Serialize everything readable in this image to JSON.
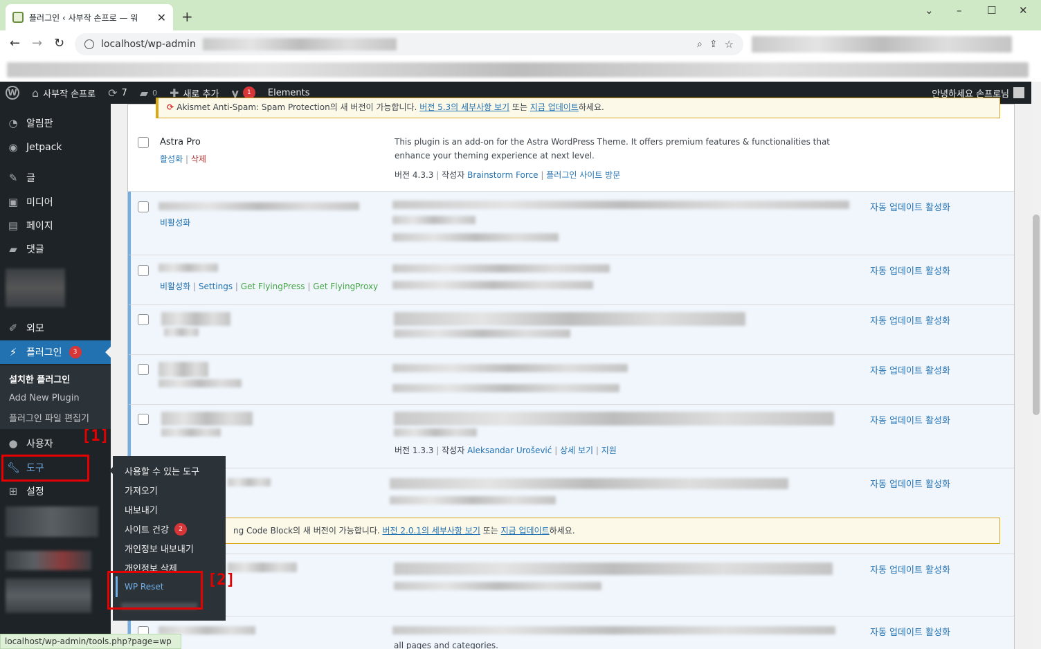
{
  "browser": {
    "tab_title": "플러그인 ‹ 사부작 손프로 — 워",
    "tab_close": "✕",
    "new_tab": "+",
    "url": "localhost/wp-admin",
    "nav_back": "←",
    "nav_forward": "→",
    "nav_reload": "↻",
    "win_min": "–",
    "win_max": "☐",
    "win_close": "✕",
    "win_chevron": "⌄"
  },
  "adminbar": {
    "site_name": "사부작 손프로",
    "updates_count": "7",
    "comments_count": "0",
    "new_label": "새로 추가",
    "yoast_badge": "1",
    "elements_label": "Elements",
    "greeting": "안녕하세요 손프로님"
  },
  "sidebar": {
    "dashboard": "알림판",
    "jetpack": "Jetpack",
    "posts": "글",
    "media": "미디어",
    "pages": "페이지",
    "comments": "댓글",
    "appearance": "외모",
    "plugins": "플러그인",
    "plugins_badge": "3",
    "submenu": {
      "installed": "설치한 플러그인",
      "add_new": "Add New Plugin",
      "editor": "플러그인 파일 편집기"
    },
    "users": "사용자",
    "tools": "도구",
    "settings": "설정"
  },
  "tools_flyout": {
    "available": "사용할 수 있는 도구",
    "import": "가져오기",
    "export": "내보내기",
    "site_health": "사이트 건강",
    "site_health_badge": "2",
    "export_personal": "개인정보 내보내기",
    "erase_personal": "개인정보 삭제",
    "wp_reset": "WP Reset"
  },
  "annotations": {
    "one": "[1]",
    "two": "[2]"
  },
  "plugins": {
    "akismet_notice": {
      "text": "Akismet Anti-Spam: Spam Protection의 새 버전이 가능합니다.",
      "link1": "버전 5.3의 세부사항 보기",
      "mid": "또는",
      "link2": "지금 업데이트",
      "tail": "하세요."
    },
    "astra": {
      "name": "Astra Pro",
      "activate": "활성화",
      "delete": "삭제",
      "desc": "This plugin is an add-on for the Astra WordPress Theme. It offers premium features & functionalities that enhance your theming experience at next level.",
      "version": "버전 4.3.3",
      "by": "작성자",
      "author": "Brainstorm Force",
      "visit": "플러그인 사이트 방문"
    },
    "row2": {
      "deactivate": "비활성화",
      "auto": "자동 업데이트 활성화"
    },
    "row3": {
      "deactivate": "비활성화",
      "settings": "Settings",
      "get_flyingpress": "Get FlyingPress",
      "get_flyingproxy": "Get FlyingProxy",
      "auto": "자동 업데이트 활성화"
    },
    "row4": {
      "auto": "자동 업데이트 활성화"
    },
    "row5": {
      "auto": "자동 업데이트 활성화"
    },
    "row6": {
      "version": "버전 1.3.3",
      "by": "작성자",
      "author": "Aleksandar Urošević",
      "details": "상세 보기",
      "support": "지원",
      "auto": "자동 업데이트 활성화"
    },
    "row7": {
      "auto": "자동 업데이트 활성화"
    },
    "code_notice": {
      "text": "ng Code Block의 새 버전이 가능합니다.",
      "link1": "버전 2.0.1의 세부사항 보기",
      "mid": "또는",
      "link2": "지금 업데이트",
      "tail": "하세요."
    },
    "row8": {
      "auto": "자동 업데이트 활성화"
    },
    "row9": {
      "auto": "자동 업데이트 활성화",
      "partial": "all pages and categories."
    }
  },
  "statusbar": "localhost/wp-admin/tools.php?page=wp"
}
